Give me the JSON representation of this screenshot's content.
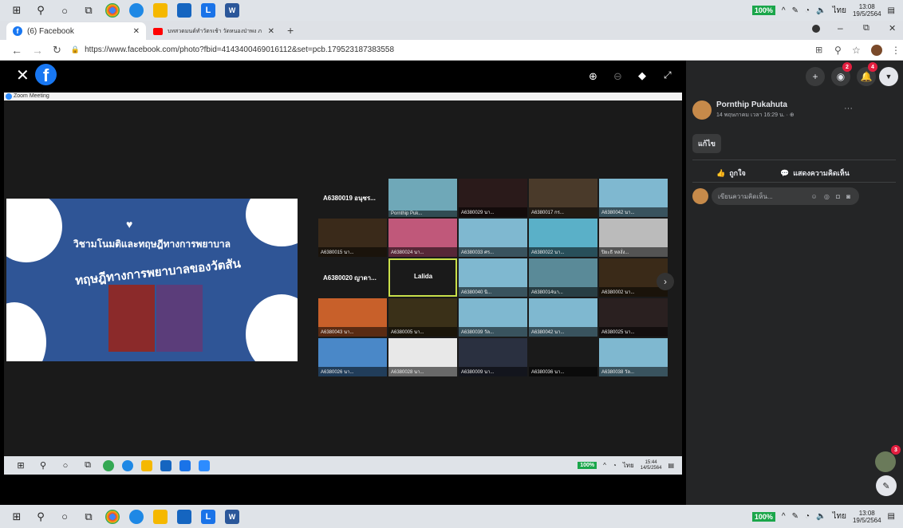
{
  "taskbar": {
    "battery_pct": "100%",
    "lang": "ไทย",
    "time": "13:08",
    "date": "19/5/2564",
    "notif_icon": "notification-icon"
  },
  "browser": {
    "tabs": [
      {
        "label": "(6) Facebook",
        "icon": "facebook-icon"
      },
      {
        "label": "บทสวดมนต์ทำวัตรเช้า วัดหนองป่าพง ภ",
        "icon": "youtube-icon"
      }
    ],
    "new_tab": "+",
    "url": "https://www.facebook.com/photo?fbid=4143400469016112&set=pcb.179523187383558"
  },
  "viewer": {
    "zoom_title": "Zoom Meeting"
  },
  "slide": {
    "title": "วิชามโนมติและทฤษฎีทางการพยาบาล",
    "subtitle": "ทฤษฎีทางการพยาบาลของวัตสัน"
  },
  "grid": [
    [
      "A6380019 อนุชร...",
      "Pornthip Puk...",
      "A6380029 นา...",
      "A6380017 กร...",
      "A6380042 นา..."
    ],
    [
      "A6380015 นา...",
      "A6380024 นา...",
      "A6380033 ศร...",
      "A6380022 นา...",
      "ปิยะธิ หลงั่ง..."
    ],
    [
      "A6380020 ญาดา...",
      "Lalida",
      "A6380040 นิ...",
      "A6380014นา...",
      "A6380002 นา..."
    ],
    [
      "A6380043 นา...",
      "A6380005 นา...",
      "A6380039 วัล...",
      "A6380042 นา...",
      "A6380025 นา..."
    ],
    [
      "A6380026 นา...",
      "A6380028 นา...",
      "A6380009 นา...",
      "A6380036 นา...",
      "A6380038 วัล..."
    ]
  ],
  "zoom_taskbar": {
    "battery_pct": "100%",
    "lang": "ไทย",
    "time": "15:44",
    "date": "14/5/2564"
  },
  "side": {
    "author": "Pornthip Pukahuta",
    "posted": "14 พฤษภาคม เวลา 16:29 น. · ⊕",
    "edit_label": "แก้ไข",
    "like_label": "ถูกใจ",
    "comment_label": "แสดงความคิดเห็น",
    "comment_placeholder": "เขียนความคิดเห็น...",
    "more": "···",
    "messenger_badge": "2",
    "notif_badge": "4",
    "chat_badge": "3"
  }
}
